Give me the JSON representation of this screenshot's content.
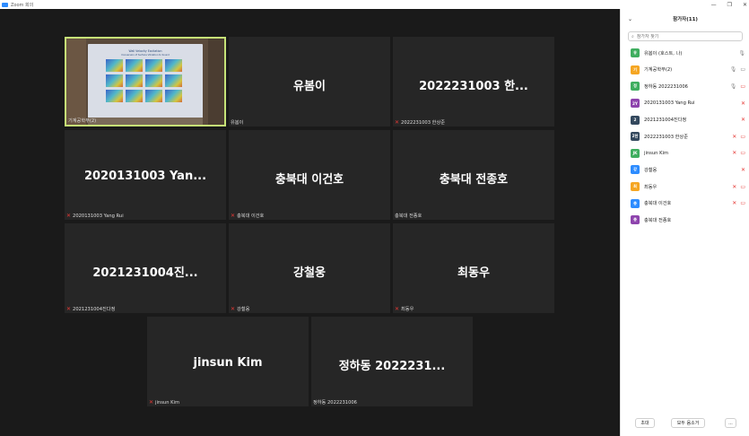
{
  "window": {
    "title": "Zoom 회의",
    "controls": [
      "—",
      "❐",
      "✕"
    ]
  },
  "tiles": [
    {
      "label": "기계공학부(2)",
      "display": "",
      "muted": false,
      "video": true
    },
    {
      "label": "유봄이",
      "display": "유봄이",
      "muted": false
    },
    {
      "label": "2022231003 한상준",
      "display": "2022231003 한...",
      "muted": true
    },
    {
      "label": "2020131003 Yang Rui",
      "display": "2020131003  Yan...",
      "muted": true
    },
    {
      "label": "충북대 이건호",
      "display": "충북대 이건호",
      "muted": true
    },
    {
      "label": "충북대 전종호",
      "display": "충북대 전종호",
      "muted": false
    },
    {
      "label": "2021231004진다정",
      "display": "2021231004진...",
      "muted": true
    },
    {
      "label": "강철웅",
      "display": "강철웅",
      "muted": true
    },
    {
      "label": "최동우",
      "display": "최동우",
      "muted": true
    },
    {
      "label": "jinsun Kim",
      "display": "jinsun Kim",
      "muted": true
    },
    {
      "label": "정하동 2022231006",
      "display": "정하동 2022231...",
      "muted": false
    }
  ],
  "slide": {
    "title": "Wall Velocity Excitation",
    "subtitle": "Conversion of Surface Vibration to Sound"
  },
  "sidebar": {
    "title": "참가자(11)",
    "collapse_icon": "⌄",
    "search_placeholder": "참가자 찾기",
    "participants": [
      {
        "initial": "유",
        "color": "#3fae5f",
        "name": "유봄이 (호스트, 나)",
        "mic": "on",
        "cam": "none"
      },
      {
        "initial": "기",
        "color": "#f5a623",
        "name": "기계공학부(2)",
        "mic": "on",
        "cam": "on"
      },
      {
        "initial": "정",
        "color": "#3fae5f",
        "name": "정하동 2022231006",
        "mic": "on",
        "cam": "off"
      },
      {
        "initial": "2Y",
        "color": "#8e44ad",
        "name": "2020131003 Yang Rui",
        "mic": "off",
        "cam": "none"
      },
      {
        "initial": "2",
        "color": "#34495e",
        "name": "2021231004진다정",
        "mic": "off",
        "cam": "none"
      },
      {
        "initial": "2한",
        "color": "#34495e",
        "name": "2022231003 한상준",
        "mic": "off",
        "cam": "off"
      },
      {
        "initial": "JK",
        "color": "#3fae5f",
        "name": "jinsun Kim",
        "mic": "off",
        "cam": "off"
      },
      {
        "initial": "강",
        "color": "#2d8cff",
        "name": "강철웅",
        "mic": "off",
        "cam": "none"
      },
      {
        "initial": "최",
        "color": "#f5a623",
        "name": "최동우",
        "mic": "off",
        "cam": "off"
      },
      {
        "initial": "충",
        "color": "#2d8cff",
        "name": "충북대 이건호",
        "mic": "off",
        "cam": "off"
      },
      {
        "initial": "충",
        "color": "#8e44ad",
        "name": "충북대 전종호",
        "mic": "none",
        "cam": "none"
      }
    ],
    "footer": {
      "invite": "초대",
      "mute_all": "모두 음소거",
      "more": "..."
    }
  },
  "icons": {
    "mic_on": "🎙",
    "mic_off": "✕",
    "cam_on": "▭",
    "cam_off": "▭",
    "search": "🔍"
  }
}
